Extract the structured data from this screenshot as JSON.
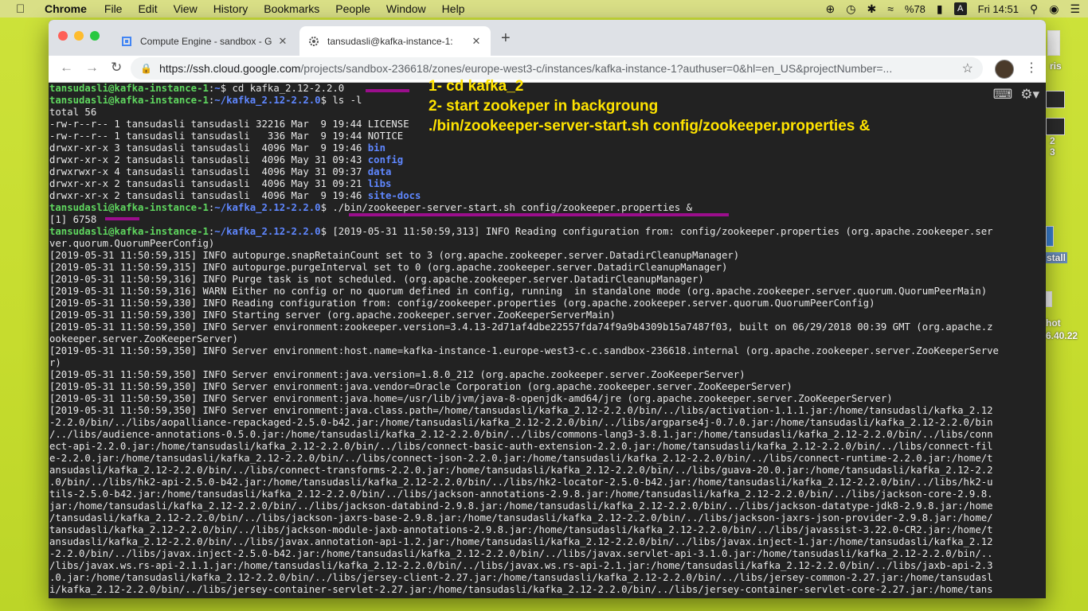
{
  "menubar": {
    "apple": "",
    "app": "Chrome",
    "items": [
      "File",
      "Edit",
      "View",
      "History",
      "Bookmarks",
      "People",
      "Window",
      "Help"
    ],
    "battery": "%78",
    "input_source": "A",
    "clock": "Fri 14:51"
  },
  "desktop": {
    "labels": [
      "ris",
      "2",
      "3",
      "stall",
      "hot",
      "6.40.22"
    ]
  },
  "browser": {
    "tabs": [
      {
        "title": "Compute Engine - sandbox - G"
      },
      {
        "title": "tansudasli@kafka-instance-1: "
      }
    ],
    "url_host": "https://ssh.cloud.google.com",
    "url_path": "/projects/sandbox-236618/zones/europe-west3-c/instances/kafka-instance-1?authuser=0&hl=en_US&projectNumber=..."
  },
  "terminal": {
    "prompt_user": "tansudasli@kafka-instance-1",
    "path_home": "~",
    "path_kafka": "~/kafka_2.12-2.2.0",
    "cmd1": " cd kafka_2.12-2.2.0",
    "cmd2": " ls -l",
    "total": "total 56",
    "ls_rows": [
      {
        "meta": "-rw-r--r-- 1 tansudasli tansudasli 32216 Mar  9 19:44 ",
        "name": "LICENSE",
        "dir": false
      },
      {
        "meta": "-rw-r--r-- 1 tansudasli tansudasli   336 Mar  9 19:44 ",
        "name": "NOTICE",
        "dir": false
      },
      {
        "meta": "drwxr-xr-x 3 tansudasli tansudasli  4096 Mar  9 19:46 ",
        "name": "bin",
        "dir": true
      },
      {
        "meta": "drwxr-xr-x 2 tansudasli tansudasli  4096 May 31 09:43 ",
        "name": "config",
        "dir": true
      },
      {
        "meta": "drwxrwxr-x 4 tansudasli tansudasli  4096 May 31 09:37 ",
        "name": "data",
        "dir": true
      },
      {
        "meta": "drwxr-xr-x 2 tansudasli tansudasli  4096 May 31 09:21 ",
        "name": "libs",
        "dir": true
      },
      {
        "meta": "drwxr-xr-x 2 tansudasli tansudasli  4096 Mar  9 19:46 ",
        "name": "site-docs",
        "dir": true
      }
    ],
    "cmd3": " ./bin/zookeeper-server-start.sh config/zookeeper.properties &",
    "job": "[1] 6758",
    "log_first": " [2019-05-31 11:50:59,313] INFO Reading configuration from: config/zookeeper.properties (org.apache.zookeeper.ser",
    "log_lines": [
      "ver.quorum.QuorumPeerConfig)",
      "[2019-05-31 11:50:59,315] INFO autopurge.snapRetainCount set to 3 (org.apache.zookeeper.server.DatadirCleanupManager)",
      "[2019-05-31 11:50:59,315] INFO autopurge.purgeInterval set to 0 (org.apache.zookeeper.server.DatadirCleanupManager)",
      "[2019-05-31 11:50:59,316] INFO Purge task is not scheduled. (org.apache.zookeeper.server.DatadirCleanupManager)",
      "[2019-05-31 11:50:59,316] WARN Either no config or no quorum defined in config, running  in standalone mode (org.apache.zookeeper.server.quorum.QuorumPeerMain)",
      "[2019-05-31 11:50:59,330] INFO Reading configuration from: config/zookeeper.properties (org.apache.zookeeper.server.quorum.QuorumPeerConfig)",
      "[2019-05-31 11:50:59,330] INFO Starting server (org.apache.zookeeper.server.ZooKeeperServerMain)",
      "[2019-05-31 11:50:59,350] INFO Server environment:zookeeper.version=3.4.13-2d71af4dbe22557fda74f9a9b4309b15a7487f03, built on 06/29/2018 00:39 GMT (org.apache.z",
      "ookeeper.server.ZooKeeperServer)",
      "[2019-05-31 11:50:59,350] INFO Server environment:host.name=kafka-instance-1.europe-west3-c.c.sandbox-236618.internal (org.apache.zookeeper.server.ZooKeeperServe",
      "r)",
      "[2019-05-31 11:50:59,350] INFO Server environment:java.version=1.8.0_212 (org.apache.zookeeper.server.ZooKeeperServer)",
      "[2019-05-31 11:50:59,350] INFO Server environment:java.vendor=Oracle Corporation (org.apache.zookeeper.server.ZooKeeperServer)",
      "[2019-05-31 11:50:59,350] INFO Server environment:java.home=/usr/lib/jvm/java-8-openjdk-amd64/jre (org.apache.zookeeper.server.ZooKeeperServer)",
      "[2019-05-31 11:50:59,350] INFO Server environment:java.class.path=/home/tansudasli/kafka_2.12-2.2.0/bin/../libs/activation-1.1.1.jar:/home/tansudasli/kafka_2.12",
      "-2.2.0/bin/../libs/aopalliance-repackaged-2.5.0-b42.jar:/home/tansudasli/kafka_2.12-2.2.0/bin/../libs/argparse4j-0.7.0.jar:/home/tansudasli/kafka_2.12-2.2.0/bin",
      "/../libs/audience-annotations-0.5.0.jar:/home/tansudasli/kafka_2.12-2.2.0/bin/../libs/commons-lang3-3.8.1.jar:/home/tansudasli/kafka_2.12-2.2.0/bin/../libs/conn",
      "ect-api-2.2.0.jar:/home/tansudasli/kafka_2.12-2.2.0/bin/../libs/connect-basic-auth-extension-2.2.0.jar:/home/tansudasli/kafka_2.12-2.2.0/bin/../libs/connect-fil",
      "e-2.2.0.jar:/home/tansudasli/kafka_2.12-2.2.0/bin/../libs/connect-json-2.2.0.jar:/home/tansudasli/kafka_2.12-2.2.0/bin/../libs/connect-runtime-2.2.0.jar:/home/t",
      "ansudasli/kafka_2.12-2.2.0/bin/../libs/connect-transforms-2.2.0.jar:/home/tansudasli/kafka_2.12-2.2.0/bin/../libs/guava-20.0.jar:/home/tansudasli/kafka_2.12-2.2",
      ".0/bin/../libs/hk2-api-2.5.0-b42.jar:/home/tansudasli/kafka_2.12-2.2.0/bin/../libs/hk2-locator-2.5.0-b42.jar:/home/tansudasli/kafka_2.12-2.2.0/bin/../libs/hk2-u",
      "tils-2.5.0-b42.jar:/home/tansudasli/kafka_2.12-2.2.0/bin/../libs/jackson-annotations-2.9.8.jar:/home/tansudasli/kafka_2.12-2.2.0/bin/../libs/jackson-core-2.9.8.",
      "jar:/home/tansudasli/kafka_2.12-2.2.0/bin/../libs/jackson-databind-2.9.8.jar:/home/tansudasli/kafka_2.12-2.2.0/bin/../libs/jackson-datatype-jdk8-2.9.8.jar:/home",
      "/tansudasli/kafka_2.12-2.2.0/bin/../libs/jackson-jaxrs-base-2.9.8.jar:/home/tansudasli/kafka_2.12-2.2.0/bin/../libs/jackson-jaxrs-json-provider-2.9.8.jar:/home/",
      "tansudasli/kafka_2.12-2.2.0/bin/../libs/jackson-module-jaxb-annotations-2.9.8.jar:/home/tansudasli/kafka_2.12-2.2.0/bin/../libs/javassist-3.22.0-CR2.jar:/home/t",
      "ansudasli/kafka_2.12-2.2.0/bin/../libs/javax.annotation-api-1.2.jar:/home/tansudasli/kafka_2.12-2.2.0/bin/../libs/javax.inject-1.jar:/home/tansudasli/kafka_2.12",
      "-2.2.0/bin/../libs/javax.inject-2.5.0-b42.jar:/home/tansudasli/kafka_2.12-2.2.0/bin/../libs/javax.servlet-api-3.1.0.jar:/home/tansudasli/kafka_2.12-2.2.0/bin/..",
      "/libs/javax.ws.rs-api-2.1.1.jar:/home/tansudasli/kafka_2.12-2.2.0/bin/../libs/javax.ws.rs-api-2.1.jar:/home/tansudasli/kafka_2.12-2.2.0/bin/../libs/jaxb-api-2.3",
      ".0.jar:/home/tansudasli/kafka_2.12-2.2.0/bin/../libs/jersey-client-2.27.jar:/home/tansudasli/kafka_2.12-2.2.0/bin/../libs/jersey-common-2.27.jar:/home/tansudasl",
      "i/kafka_2.12-2.2.0/bin/../libs/jersey-container-servlet-2.27.jar:/home/tansudasli/kafka_2.12-2.2.0/bin/../libs/jersey-container-servlet-core-2.27.jar:/home/tans"
    ]
  },
  "annotation": {
    "line1": "1- cd kafka_2",
    "line2": "2- start zookeper in backgroung",
    "line3": "./bin/zookeeper-server-start.sh config/zookeeper.properties &",
    "color": "#ffe300",
    "underline_color": "#9b0e8c"
  }
}
